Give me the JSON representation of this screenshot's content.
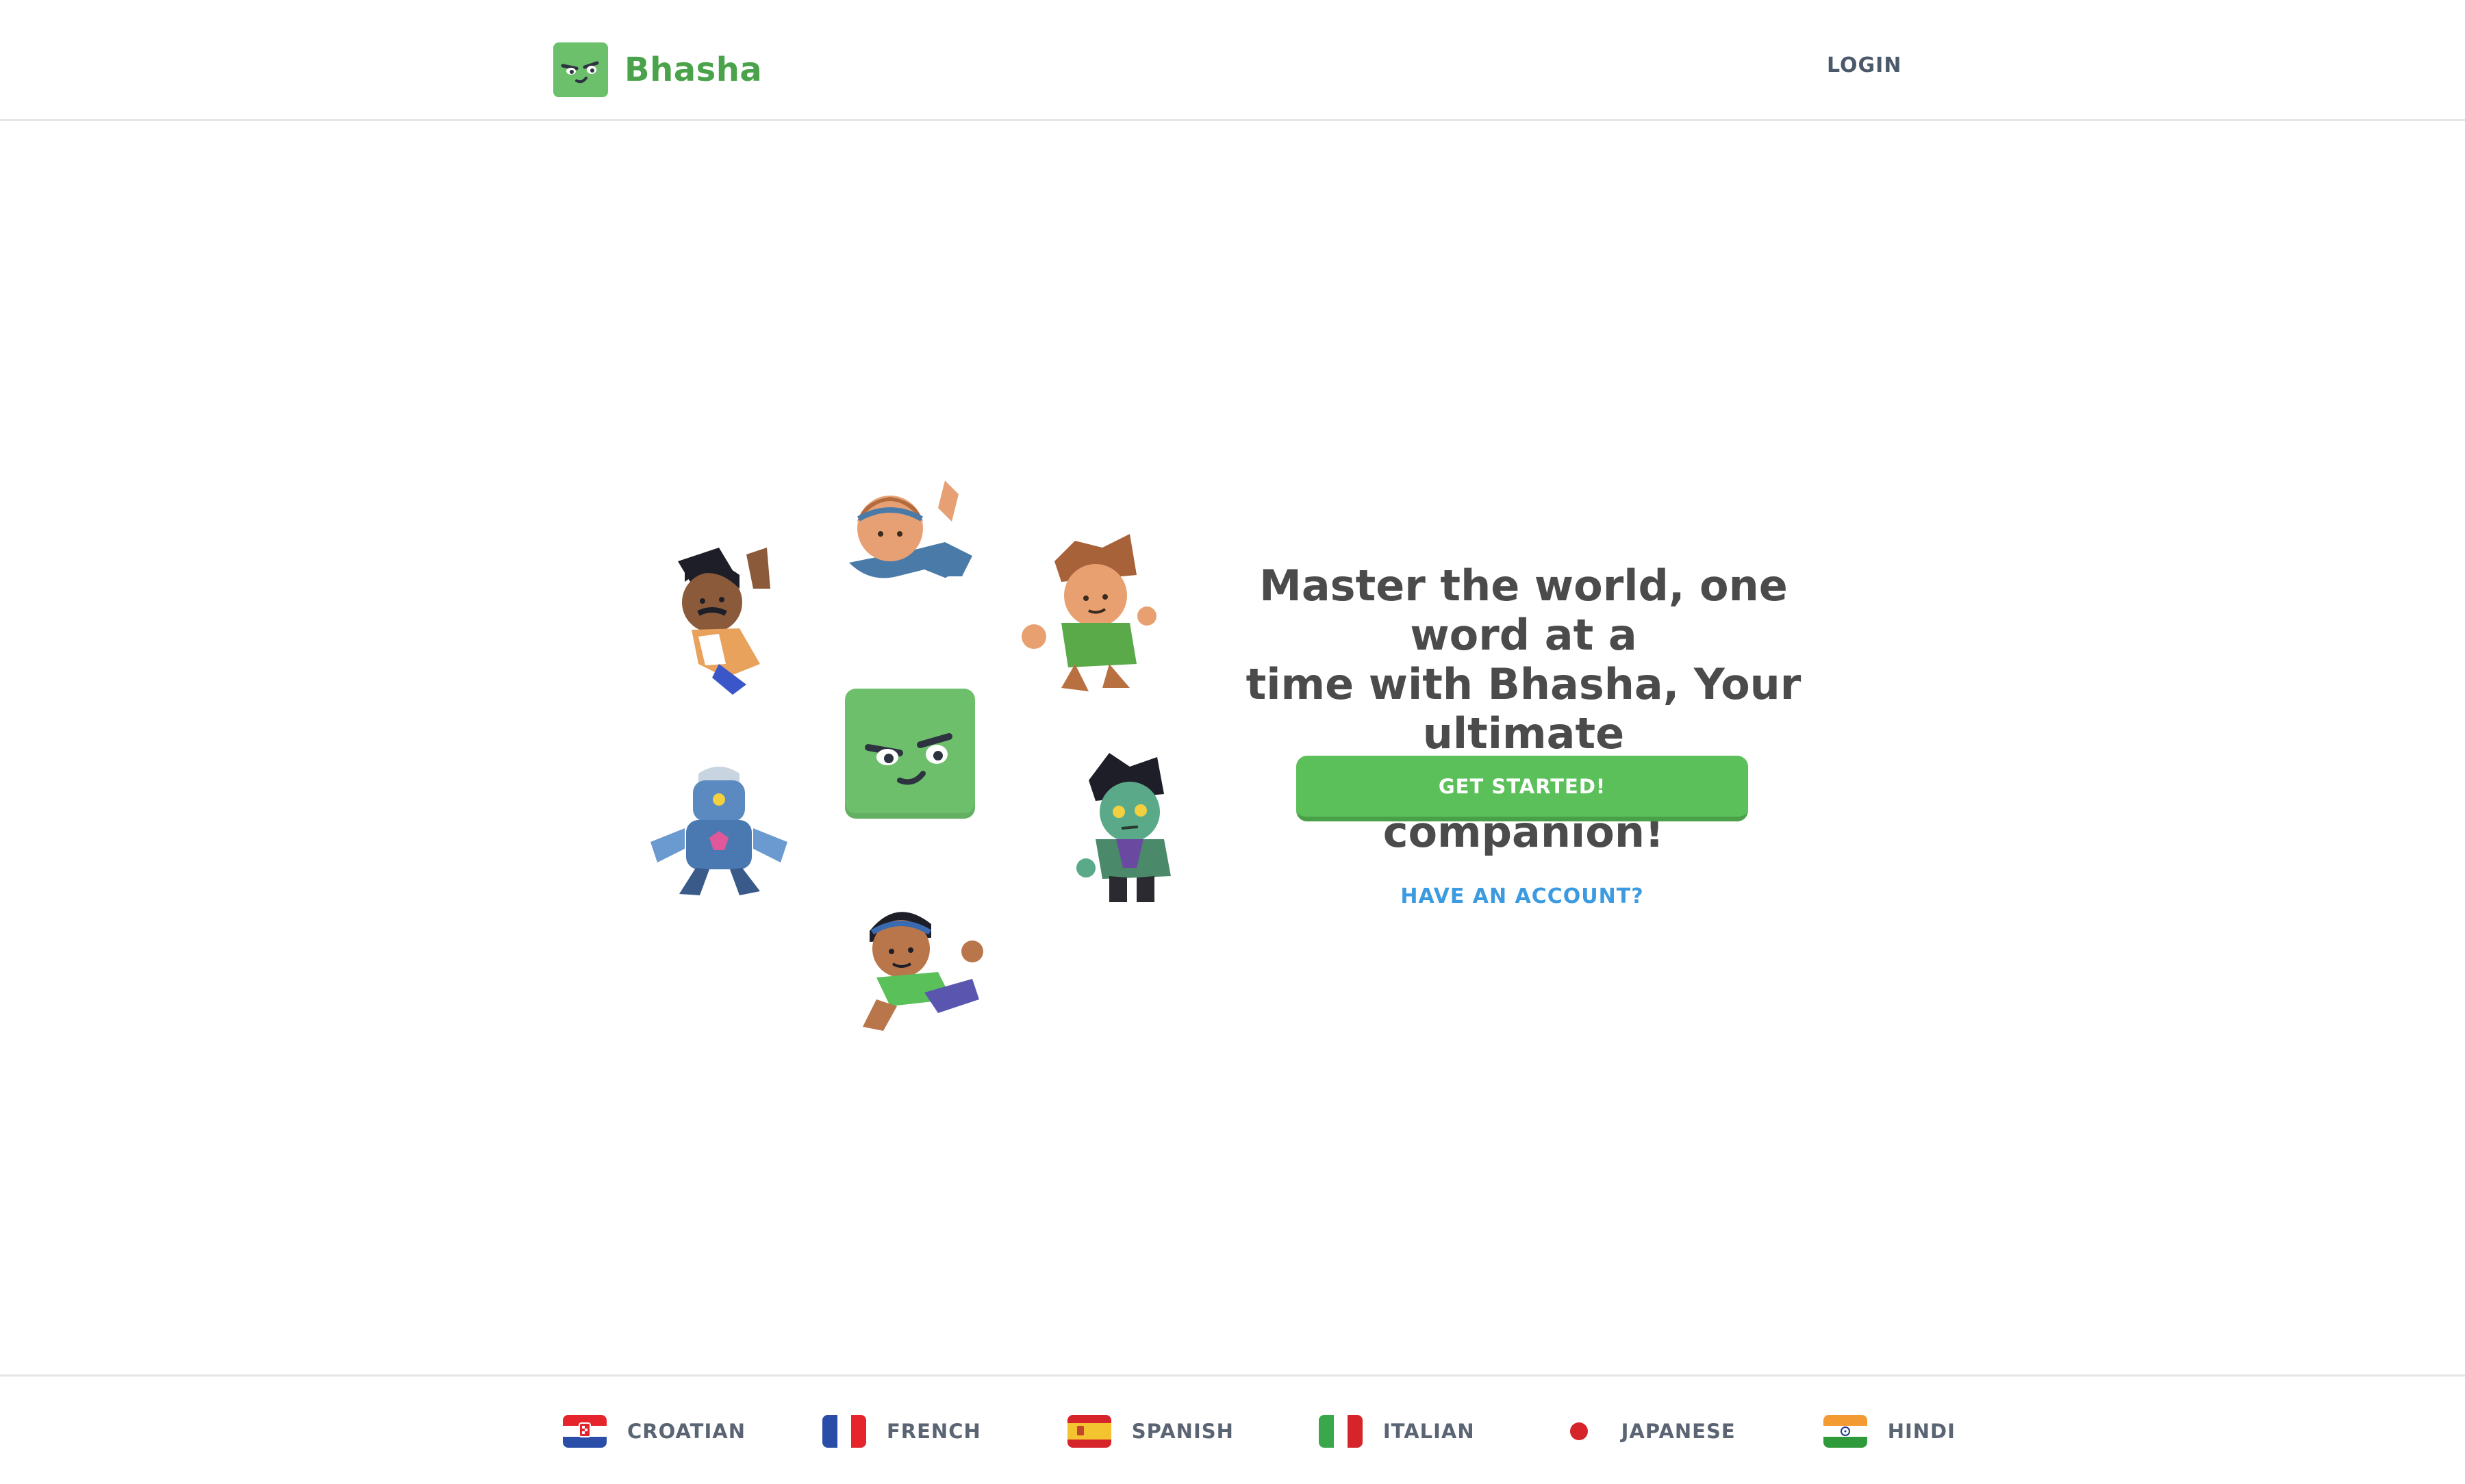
{
  "header": {
    "brand_name": "Bhasha",
    "login_label": "LOGIN"
  },
  "hero": {
    "headline_line1": "Master the world, one word at a",
    "headline_line2": "time with Bhasha, Your ultimate",
    "headline_line3": "language learning companion!",
    "primary_button": "GET STARTED!",
    "secondary_link": "HAVE AN ACCOUNT?"
  },
  "footer": {
    "languages": [
      {
        "label": "CROATIAN",
        "flag": "croatia-flag"
      },
      {
        "label": "FRENCH",
        "flag": "france-flag"
      },
      {
        "label": "SPANISH",
        "flag": "spain-flag"
      },
      {
        "label": "ITALIAN",
        "flag": "italy-flag"
      },
      {
        "label": "JAPANESE",
        "flag": "japan-flag"
      },
      {
        "label": "HINDI",
        "flag": "india-flag"
      }
    ]
  },
  "colors": {
    "brand_green": "#4aa34a",
    "button_green": "#5cc05a",
    "link_blue": "#3c9be0",
    "text_dark": "#4b4b4b"
  }
}
